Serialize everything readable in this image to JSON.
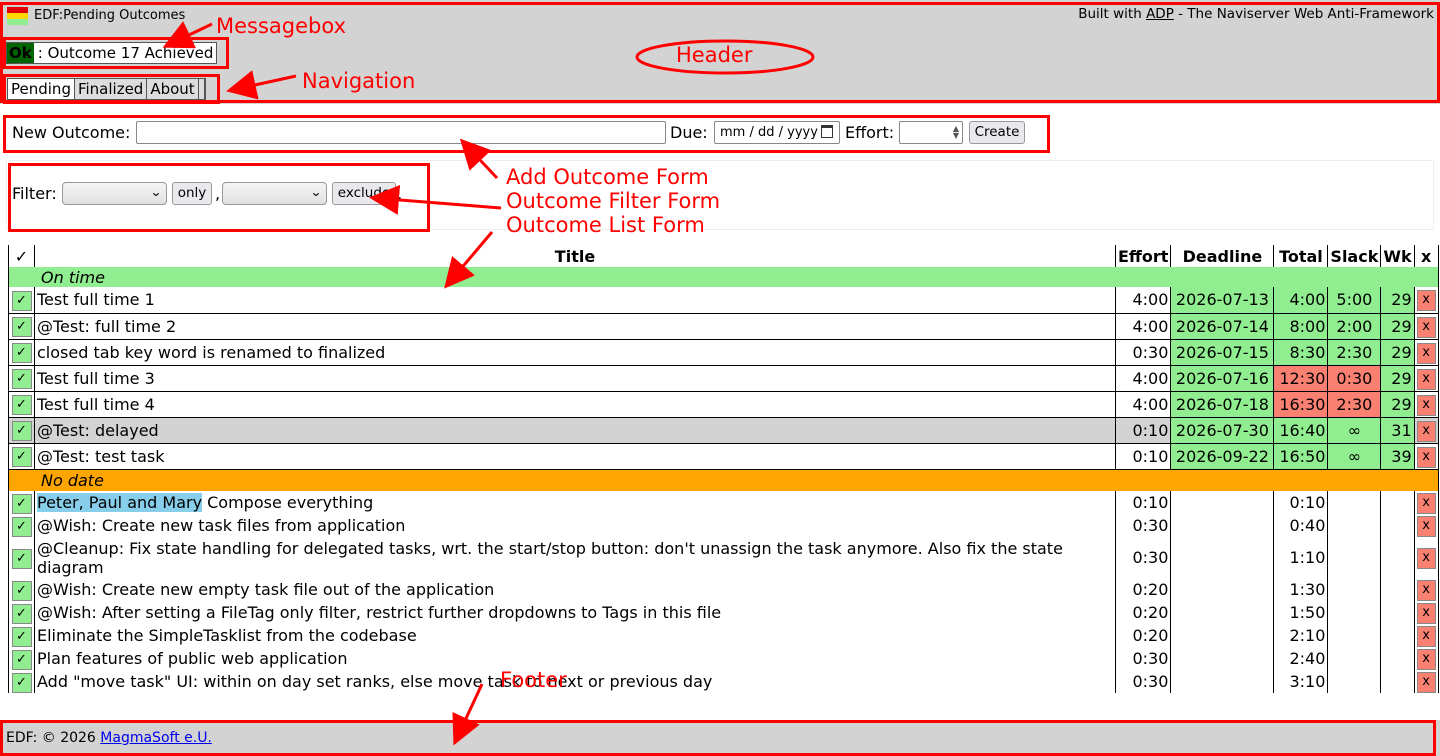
{
  "header": {
    "app_title": "EDF:Pending Outcomes",
    "built_with_prefix": "Built with ",
    "built_with_link": "ADP",
    "built_with_suffix": " - The Naviserver Web Anti-Framework",
    "logo_colors": [
      "#e00000",
      "#ffd700",
      "#90ee90"
    ],
    "background": "#d3d3d3"
  },
  "messagebox": {
    "status": "Ok",
    "separator": " : ",
    "text": "Outcome 17 Achieved",
    "status_color": "#006400"
  },
  "navigation": {
    "tabs": [
      "Pending",
      "Finalized",
      "About"
    ],
    "active": "Pending"
  },
  "add_form": {
    "new_outcome_label": "New Outcome:",
    "new_outcome_value": "",
    "due_label": "Due:",
    "due_placeholder": "mm / dd / yyyy",
    "effort_label": "Effort:",
    "effort_value": "",
    "create_button": "Create"
  },
  "filter_form": {
    "label": "Filter:",
    "select1_value": "",
    "only_button": "only",
    "comma": ",",
    "select2_value": "",
    "exclude_button": "exclude",
    "trailing_comma": ","
  },
  "table": {
    "headers": {
      "check": "✓",
      "title": "Title",
      "effort": "Effort",
      "deadline": "Deadline",
      "total": "Total",
      "slack": "Slack",
      "week": "Wk",
      "delete": "x"
    },
    "check_glyph": "✓",
    "delete_glyph": "x",
    "group_on_time": "On time",
    "group_no_date": "No date",
    "on_time_rows": [
      {
        "title": "Test full time 1",
        "effort": "4:00",
        "deadline": "2026-07-13",
        "total": "4:00",
        "slack": "5:00",
        "week": "29"
      },
      {
        "title": "@Test: full time 2",
        "effort": "4:00",
        "deadline": "2026-07-14",
        "total": "8:00",
        "slack": "2:00",
        "week": "29"
      },
      {
        "title": "closed tab key word is renamed to finalized",
        "effort": "0:30",
        "deadline": "2026-07-15",
        "total": "8:30",
        "slack": "2:30",
        "week": "29"
      },
      {
        "title": "Test full time 3",
        "effort": "4:00",
        "deadline": "2026-07-16",
        "total": "12:30",
        "slack": "0:30",
        "week": "29"
      },
      {
        "title": "Test full time 4",
        "effort": "4:00",
        "deadline": "2026-07-18",
        "total": "16:30",
        "slack": "2:30",
        "week": "29"
      },
      {
        "title": "@Test: delayed",
        "effort": "0:10",
        "deadline": "2026-07-30",
        "total": "16:40",
        "slack": "∞",
        "week": "31"
      },
      {
        "title": "@Test: test task",
        "effort": "0:10",
        "deadline": "2026-09-22",
        "total": "16:50",
        "slack": "∞",
        "week": "39"
      }
    ],
    "no_date_first": {
      "highlight": "Peter, Paul and Mary",
      "rest": " Compose everything",
      "effort": "0:10",
      "total": "0:10"
    },
    "no_date_rows": [
      {
        "title": "@Wish: Create new task files from application",
        "effort": "0:30",
        "total": "0:40"
      },
      {
        "title": "@Cleanup: Fix state handling for delegated tasks, wrt. the start/stop button: don't unassign the task anymore. Also fix the state diagram",
        "effort": "0:30",
        "total": "1:10"
      },
      {
        "title": "@Wish: Create new empty task file out of the application",
        "effort": "0:20",
        "total": "1:30"
      },
      {
        "title": "@Wish: After setting a FileTag only filter, restrict further dropdowns to Tags in this file",
        "effort": "0:20",
        "total": "1:50"
      },
      {
        "title": "Eliminate the SimpleTasklist from the codebase",
        "effort": "0:20",
        "total": "2:10"
      },
      {
        "title": "Plan features of public web application",
        "effort": "0:30",
        "total": "2:40"
      },
      {
        "title": "Add \"move task\" UI: within on day set ranks, else move task to next or previous day",
        "effort": "0:30",
        "total": "3:10"
      }
    ],
    "colors": {
      "green": "#90ee90",
      "red": "#fa8072",
      "group_on_time": "#90ee90",
      "group_no_date": "#ffa500",
      "selected_row": "#d3d3d3",
      "highlight": "#87ceeb"
    }
  },
  "footer": {
    "text": "EDF: © 2026 ",
    "link": "MagmaSoft e.U."
  },
  "annotations": {
    "messagebox": "Messagebox",
    "header": "Header",
    "navigation": "Navigation",
    "add_form": "Add Outcome Form",
    "filter_form": "Outcome Filter Form",
    "list_form": "Outcome List Form",
    "footer": "Footer",
    "color": "#ff0000"
  }
}
